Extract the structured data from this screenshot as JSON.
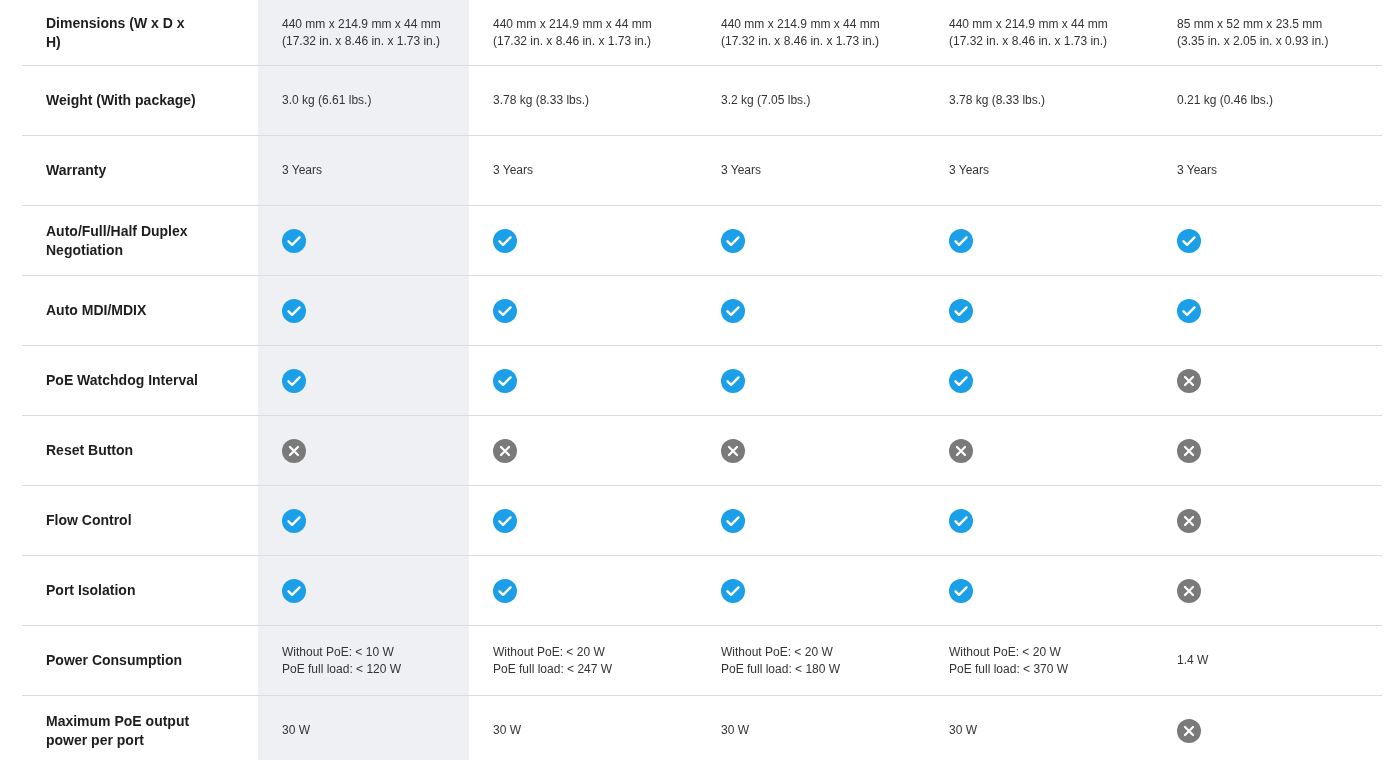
{
  "columns": [
    {
      "highlighted": true
    },
    {
      "highlighted": false
    },
    {
      "highlighted": false
    },
    {
      "highlighted": false
    },
    {
      "highlighted": false
    }
  ],
  "rows": [
    {
      "label": "Dimensions (W x D x H)",
      "cells": [
        {
          "kind": "text",
          "text": "440 mm x 214.9 mm x 44 mm (17.32 in. x 8.46 in. x 1.73 in.)"
        },
        {
          "kind": "text",
          "text": "440 mm x 214.9 mm x 44 mm\n(17.32 in. x 8.46 in. x 1.73 in.)"
        },
        {
          "kind": "text",
          "text": "440 mm x 214.9 mm x 44 mm\n(17.32 in. x 8.46 in. x 1.73 in.)"
        },
        {
          "kind": "text",
          "text": "440 mm x 214.9 mm x 44 mm\n(17.32 in. x 8.46 in. x 1.73 in.)"
        },
        {
          "kind": "text",
          "text": "85 mm x 52 mm x 23.5 mm\n(3.35 in. x 2.05 in. x 0.93 in.)"
        }
      ]
    },
    {
      "label": "Weight (With package)",
      "cells": [
        {
          "kind": "text",
          "text": "3.0 kg (6.61 lbs.)"
        },
        {
          "kind": "text",
          "text": "3.78 kg (8.33 lbs.)"
        },
        {
          "kind": "text",
          "text": "3.2 kg (7.05 lbs.)"
        },
        {
          "kind": "text",
          "text": "3.78 kg (8.33 lbs.)"
        },
        {
          "kind": "text",
          "text": "0.21 kg (0.46 lbs.)"
        }
      ]
    },
    {
      "label": "Warranty",
      "cells": [
        {
          "kind": "text",
          "text": "3 Years"
        },
        {
          "kind": "text",
          "text": "3 Years"
        },
        {
          "kind": "text",
          "text": "3 Years"
        },
        {
          "kind": "text",
          "text": "3 Years"
        },
        {
          "kind": "text",
          "text": "3 Years"
        }
      ]
    },
    {
      "label": "Auto/Full/Half Duplex Negotiation",
      "cells": [
        {
          "kind": "check"
        },
        {
          "kind": "check"
        },
        {
          "kind": "check"
        },
        {
          "kind": "check"
        },
        {
          "kind": "check"
        }
      ]
    },
    {
      "label": "Auto MDI/MDIX",
      "cells": [
        {
          "kind": "check"
        },
        {
          "kind": "check"
        },
        {
          "kind": "check"
        },
        {
          "kind": "check"
        },
        {
          "kind": "check"
        }
      ]
    },
    {
      "label": "PoE Watchdog Interval",
      "cells": [
        {
          "kind": "check"
        },
        {
          "kind": "check"
        },
        {
          "kind": "check"
        },
        {
          "kind": "check"
        },
        {
          "kind": "cross"
        }
      ]
    },
    {
      "label": "Reset Button",
      "cells": [
        {
          "kind": "cross"
        },
        {
          "kind": "cross"
        },
        {
          "kind": "cross"
        },
        {
          "kind": "cross"
        },
        {
          "kind": "cross"
        }
      ]
    },
    {
      "label": "Flow Control",
      "cells": [
        {
          "kind": "check"
        },
        {
          "kind": "check"
        },
        {
          "kind": "check"
        },
        {
          "kind": "check"
        },
        {
          "kind": "cross"
        }
      ]
    },
    {
      "label": "Port Isolation",
      "cells": [
        {
          "kind": "check"
        },
        {
          "kind": "check"
        },
        {
          "kind": "check"
        },
        {
          "kind": "check"
        },
        {
          "kind": "cross"
        }
      ]
    },
    {
      "label": "Power Consumption",
      "cells": [
        {
          "kind": "text",
          "text": "Without PoE: < 10 W\nPoE full load: < 120 W"
        },
        {
          "kind": "text",
          "text": "Without PoE: < 20 W\nPoE full load: < 247 W"
        },
        {
          "kind": "text",
          "text": "Without PoE: < 20 W\nPoE full load: < 180 W"
        },
        {
          "kind": "text",
          "text": "Without PoE: < 20 W\nPoE full load: < 370 W"
        },
        {
          "kind": "text",
          "text": "1.4 W"
        }
      ]
    },
    {
      "label": "Maximum PoE output power per port",
      "cells": [
        {
          "kind": "text",
          "text": "30 W"
        },
        {
          "kind": "text",
          "text": "30 W"
        },
        {
          "kind": "text",
          "text": "30 W"
        },
        {
          "kind": "text",
          "text": "30 W"
        },
        {
          "kind": "cross"
        }
      ]
    }
  ]
}
